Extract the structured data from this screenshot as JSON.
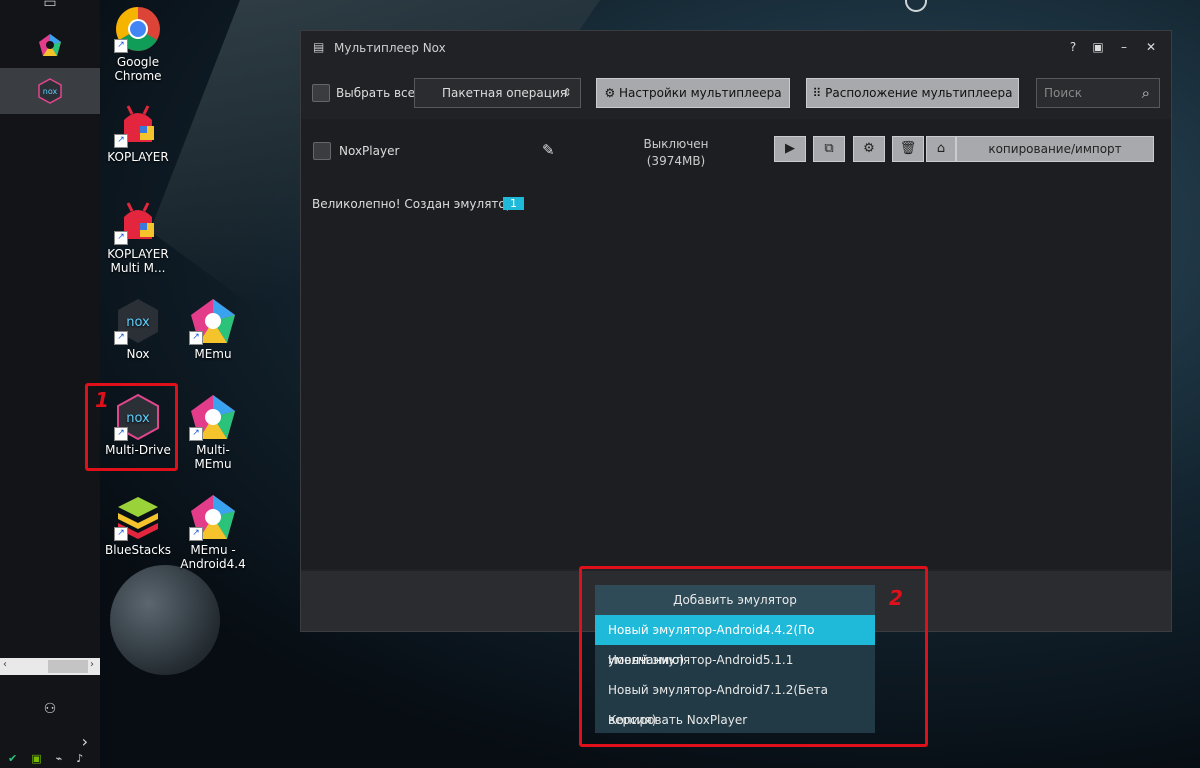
{
  "window": {
    "title": "Мультиплеер Nox",
    "select_all_label": "Выбрать все",
    "batch_operation": "Пакетная операция",
    "multiplayer_settings": "Настройки мультиплеера",
    "multiplayer_layout": "Расположение мультиплеера",
    "search_placeholder": "Поиск",
    "emulator_row": {
      "name": "NoxPlayer",
      "status": "Выключен",
      "size": "(3974MB)",
      "copy_import": "копирование/импорт"
    },
    "status_message": "Великолепно! Создан эмулятор:",
    "status_count": "1"
  },
  "dropdown": {
    "header": "Добавить эмулятор",
    "items": [
      "Новый эмулятор-Android4.4.2(По умолчанию)",
      "Новый эмулятор-Android5.1.1",
      "Новый эмулятор-Android7.1.2(Бета версия)",
      "Копировать NoxPlayer"
    ]
  },
  "desktop": {
    "icons": [
      {
        "label": "Google Chrome"
      },
      {
        "label": "KOPLAYER"
      },
      {
        "label": "KOPLAYER Multi M..."
      },
      {
        "label": "Nox"
      },
      {
        "label": "MEmu"
      },
      {
        "label": "Multi-Drive"
      },
      {
        "label": "Multi-MEmu"
      },
      {
        "label": "BlueStacks"
      },
      {
        "label": "MEmu - Android4.4"
      }
    ]
  },
  "annotations": {
    "label1": "1",
    "label2": "2"
  },
  "colors": {
    "accent": "#1fb9d9",
    "annotation": "#e0101a",
    "button_bg": "#a7a9ac"
  }
}
